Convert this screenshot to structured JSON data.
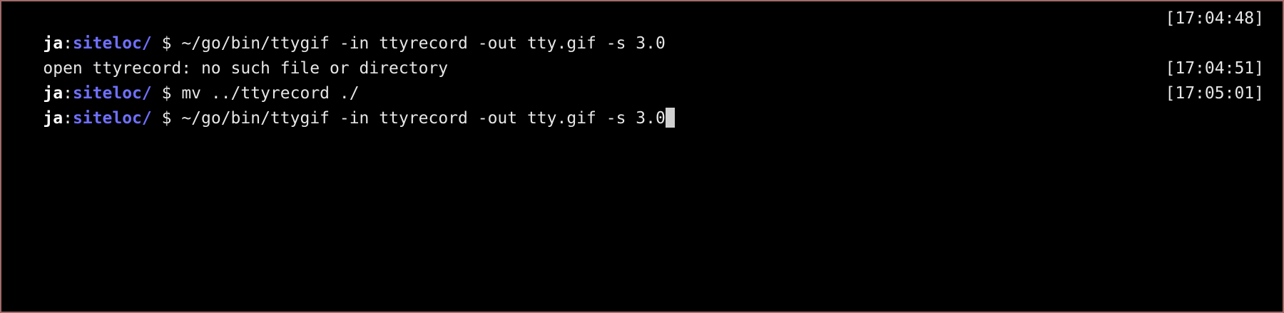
{
  "colors": {
    "background": "#000000",
    "border": "#a06a6a",
    "text": "#e6e6e6",
    "user": "#ffffff",
    "directory": "#7070ff",
    "cursor": "#d0d0d0"
  },
  "prompt": {
    "user": "ja",
    "separator": ":",
    "directory": "siteloc/",
    "symbol": "$"
  },
  "lines": [
    {
      "type": "command",
      "command": "~/go/bin/ttygif -in ttyrecord -out tty.gif -s 3.0",
      "time": "[17:04:48]"
    },
    {
      "type": "output",
      "text": "open ttyrecord: no such file or directory"
    },
    {
      "type": "command",
      "command": "mv ../ttyrecord ./",
      "time": "[17:04:51]"
    },
    {
      "type": "command",
      "command": "~/go/bin/ttygif -in ttyrecord -out tty.gif -s 3.0",
      "time": "[17:05:01]",
      "cursor": true
    }
  ]
}
